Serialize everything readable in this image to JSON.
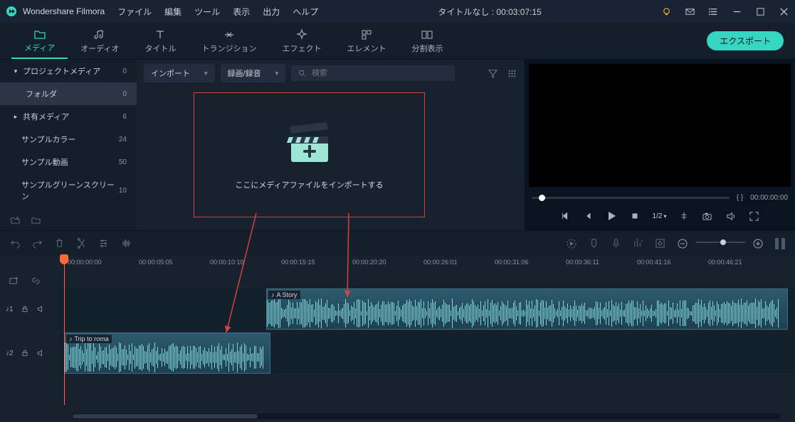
{
  "app": {
    "name": "Wondershare Filmora"
  },
  "menu": [
    "ファイル",
    "編集",
    "ツール",
    "表示",
    "出力",
    "ヘルプ"
  ],
  "title_center": "タイトルなし : 00:03:07:15",
  "tabs": [
    {
      "label": "メディア",
      "active": true
    },
    {
      "label": "オーディオ"
    },
    {
      "label": "タイトル"
    },
    {
      "label": "トランジション"
    },
    {
      "label": "エフェクト"
    },
    {
      "label": "エレメント"
    },
    {
      "label": "分割表示"
    }
  ],
  "export_label": "エクスポート",
  "sidebar": [
    {
      "label": "プロジェクトメディア",
      "count": "0",
      "chev": "▾"
    },
    {
      "label": "フォルダ",
      "count": "0",
      "active": true
    },
    {
      "label": "共有メディア",
      "count": "6",
      "chev": "▸"
    },
    {
      "label": "サンプルカラー",
      "count": "24"
    },
    {
      "label": "サンプル動画",
      "count": "50"
    },
    {
      "label": "サンプルグリーンスクリーン",
      "count": "10"
    }
  ],
  "media_toolbar": {
    "import_label": "インポート",
    "record_label": "録画/録音",
    "search_placeholder": "検索"
  },
  "drop_text": "ここにメディアファイルをインポートする",
  "preview": {
    "brackets": "{   }",
    "time": "00:00:00:00",
    "speed": "1/2"
  },
  "ruler": [
    "00:00:00:00",
    "00:00:05:05",
    "00:00:10:10",
    "00:00:15:15",
    "00:00:20:20",
    "00:00:26:01",
    "00:00:31:06",
    "00:00:36:11",
    "00:00:41:16",
    "00:00:46:21"
  ],
  "tracks": {
    "t1": {
      "name": "♪1",
      "clip_title": "A Story"
    },
    "t2": {
      "name": "♪2",
      "clip_title": "Trip to roma"
    }
  }
}
